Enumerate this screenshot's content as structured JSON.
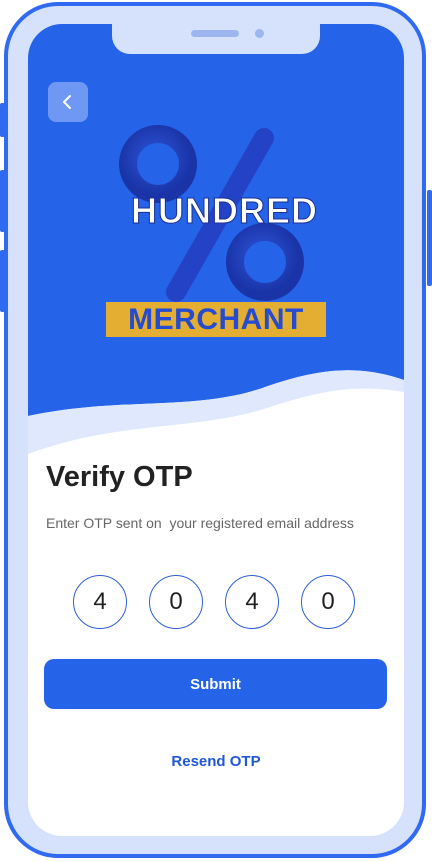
{
  "brand": {
    "logo_word": "HUNDRED",
    "logo_sub": "MERCHANT"
  },
  "icons": {
    "back": "chevron-left-icon",
    "logo": "percent-logo-icon"
  },
  "colors": {
    "primary": "#2563e8",
    "frame": "#2f6af0",
    "frame_fill": "#d6e1fb",
    "accent_gold": "#e3ae31",
    "logo_dark": "#1b2f8f"
  },
  "page": {
    "title": "Verify OTP",
    "subtitle": "Enter OTP sent on  your registered email address"
  },
  "otp": {
    "digits": [
      "4",
      "0",
      "4",
      "0"
    ]
  },
  "actions": {
    "submit_label": "Submit",
    "resend_label": "Resend OTP"
  }
}
